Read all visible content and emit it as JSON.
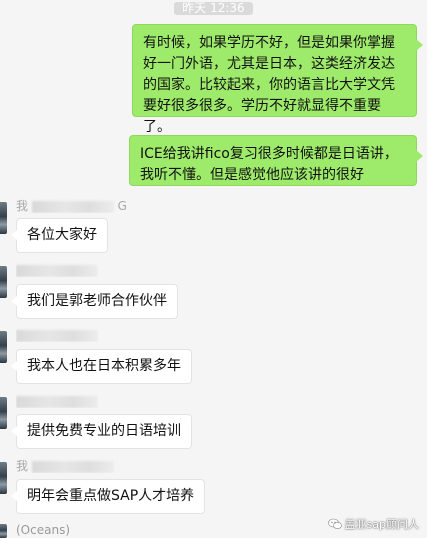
{
  "timestamp": "昨天 12:36",
  "outgoing": [
    {
      "text": "有时候，如果学历不好，但是如果你掌握好一门外语，尤其是日本，这类经济发达的国家。比较起来，你的语言比大学文凭要好很多很多。学历不好就显得不重要了。"
    },
    {
      "text": "ICE给我讲fico复习很多时候都是日语讲，我听不懂。但是感觉他应该讲的很好"
    }
  ],
  "incoming": [
    {
      "sender_visible_prefix": "我",
      "sender_visible_suffix": "G",
      "text": "各位大家好"
    },
    {
      "sender_visible_prefix": "",
      "sender_visible_suffix": "",
      "text": "我们是郭老师合作伙伴"
    },
    {
      "sender_visible_prefix": "",
      "sender_visible_suffix": "",
      "text": "我本人也在日本积累多年"
    },
    {
      "sender_visible_prefix": "",
      "sender_visible_suffix": "",
      "text": "提供免费专业的日语培训"
    },
    {
      "sender_visible_prefix": "我",
      "sender_visible_suffix": "",
      "text": "明年会重点做SAP人才培养"
    }
  ],
  "footer_sender": "(Oceans)",
  "watermark": "盖亚sap顾问人",
  "colors": {
    "outgoing_bubble": "#9eea6a",
    "incoming_bubble": "#ffffff",
    "background": "#f5f5f5"
  }
}
